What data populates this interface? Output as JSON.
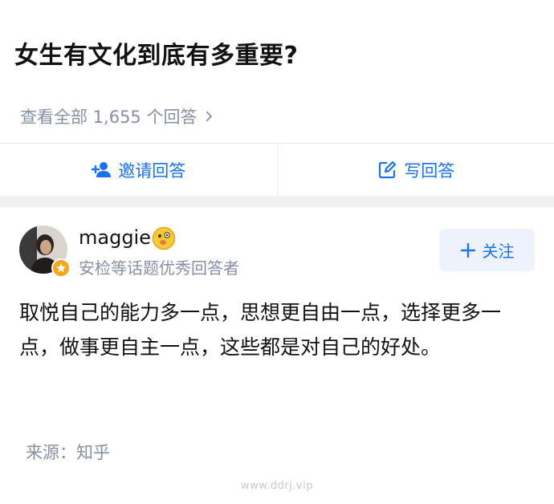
{
  "question": {
    "title": "女生有文化到底有多重要?",
    "view_all": "查看全部 1,655 个回答"
  },
  "actions": {
    "invite_label": "邀请回答",
    "write_label": "写回答"
  },
  "author": {
    "name": "maggie",
    "subtitle": "安检等话题优秀回答者",
    "follow_label": "关注"
  },
  "answer": {
    "text": "取悦自己的能力多一点，思想更自由一点，选择更多一点，做事更自主一点，这些都是对自己的好处。",
    "source": "来源：知乎"
  },
  "watermark": "www.ddrj.vip",
  "colors": {
    "accent": "#1772f6",
    "muted": "#8590a6",
    "badge": "#f7a51b"
  },
  "icons": {
    "view_all": "chevron-right-icon",
    "invite": "add-user-icon",
    "write": "edit-icon",
    "follow": "plus-icon",
    "badge": "star-badge-icon",
    "emoji": "emoji-icon"
  }
}
